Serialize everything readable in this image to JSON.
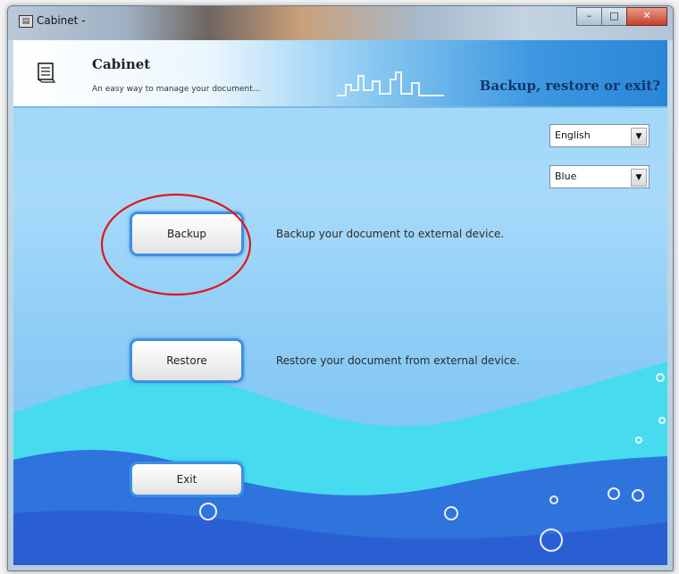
{
  "window": {
    "title": "Cabinet -"
  },
  "header": {
    "app_name": "Cabinet",
    "tagline": "An easy way to manage your document...",
    "prompt": "Backup, restore or exit?"
  },
  "settings": {
    "language": {
      "selected": "English"
    },
    "theme": {
      "selected": "Blue"
    }
  },
  "actions": {
    "backup": {
      "label": "Backup",
      "description": "Backup your document to external device."
    },
    "restore": {
      "label": "Restore",
      "description": "Restore your document from external device."
    },
    "exit": {
      "label": "Exit"
    }
  },
  "colors": {
    "accent": "#3d8fe6",
    "wave_light": "#3ee3f0",
    "wave_dark": "#2b63d9",
    "callout": "#e01818"
  }
}
